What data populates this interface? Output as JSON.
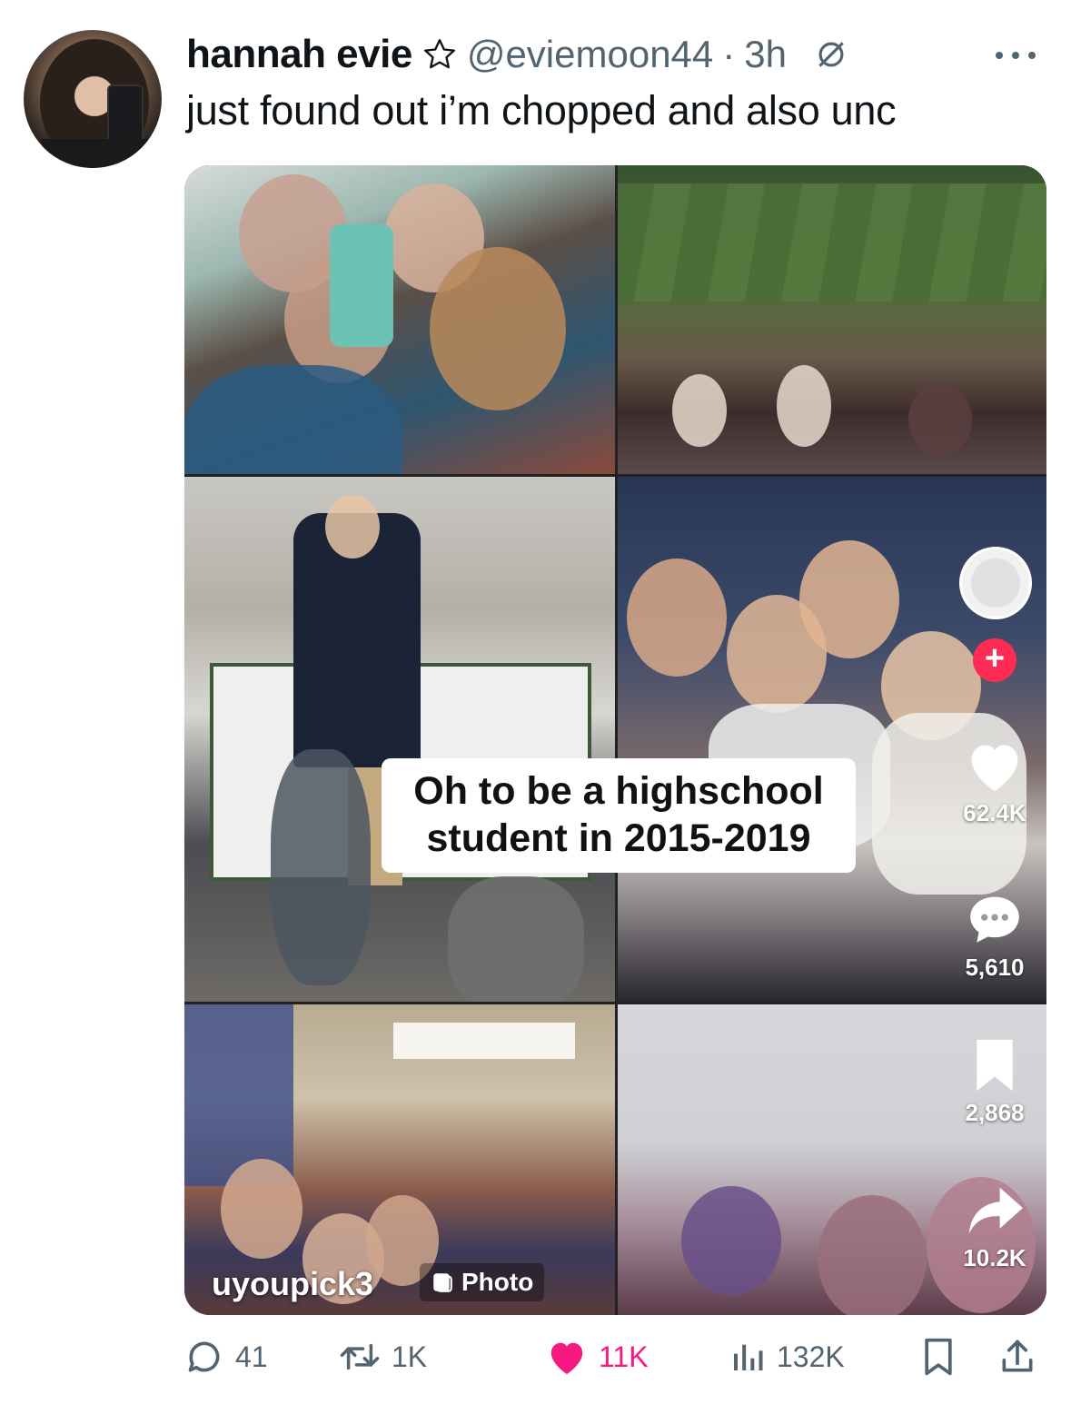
{
  "author": {
    "display_name": "hannah evie",
    "handle": "@eviemoon44",
    "separator": "·",
    "age": "3h"
  },
  "tweet": {
    "text": "just found out i’m chopped and also unc"
  },
  "media": {
    "caption": "Oh to be a highschool student in 2015-2019",
    "tiktok": {
      "likes": "62.4K",
      "comments": "5,610",
      "saves": "2,868",
      "shares": "10.2K",
      "username": "uyoupick3",
      "type_label": "Photo",
      "follow_symbol": "+"
    }
  },
  "actions": {
    "replies": "41",
    "reposts": "1K",
    "likes": "11K",
    "views": "132K"
  },
  "colors": {
    "like_pink": "#f91880",
    "tiktok_red": "#fe2c55",
    "meta_gray": "#536471"
  }
}
